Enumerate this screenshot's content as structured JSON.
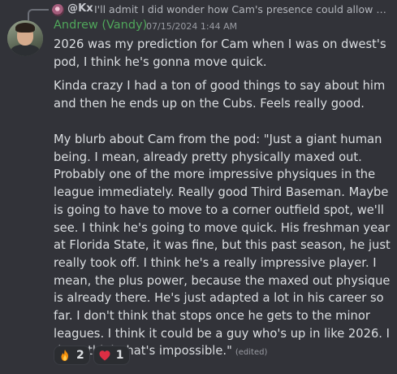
{
  "reply": {
    "author": "@Kx",
    "text": "I'll admit I did wonder how Cam's presence could allow the ..."
  },
  "message": {
    "author": "Andrew (Vandy)",
    "timestamp": "07/15/2024 1:44 AM",
    "author_color": "#4fa65a",
    "paragraph1": "2026 was my prediction for Cam when I was on dwest's pod, I think he's gonna move quick.",
    "paragraph2": "Kinda crazy I had a ton of good things to say about him and then he ends up on the Cubs. Feels really good.",
    "paragraph3": "My blurb about Cam from the pod: \"Just a giant human being. I mean, already pretty physically maxed out. Probably one of the more impressive physiques in the league immediately. Really good Third Baseman. Maybe is going to have to move to a corner outfield spot, we'll see. I think he's going to move quick. His freshman year at Florida State, it was fine, but this past season, he just really took off. I think he's a really impressive player. I mean, the plus power, because the maxed out physique is already there. He's just adapted a lot in his career so far. I don't think that stops once he gets to the minor leagues. I think it could be a guy who's up in like 2026. I don't think that's impossible.\"",
    "edited_label": "(edited)"
  },
  "reactions": [
    {
      "icon": "fire-emoji-icon",
      "count": "2"
    },
    {
      "icon": "heart-emoji-icon",
      "count": "1"
    }
  ]
}
